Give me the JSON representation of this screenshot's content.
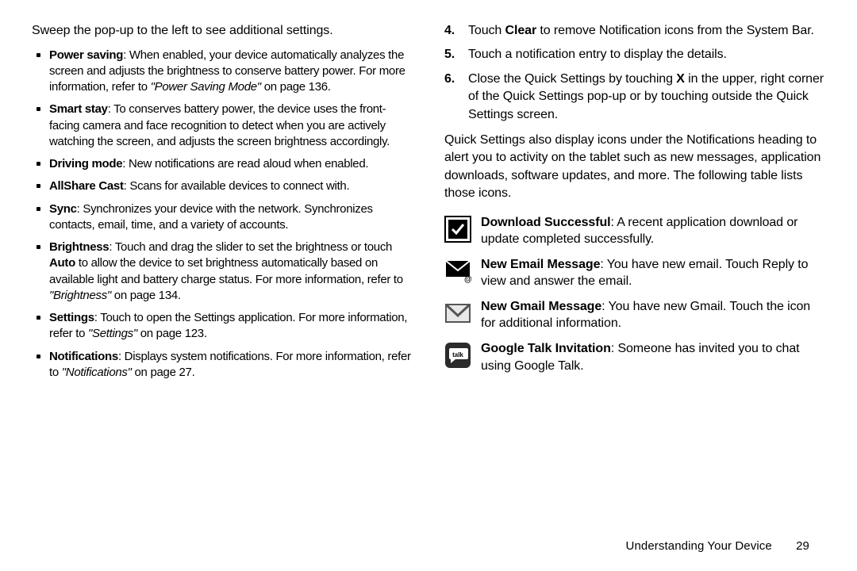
{
  "left": {
    "intro": "Sweep the pop-up to the left to see additional settings.",
    "bullets": [
      {
        "title": "Power saving",
        "body": ": When enabled, your device automatically analyzes the screen and adjusts the brightness to conserve battery power. For more information, refer to ",
        "ref": "\"Power Saving Mode\"",
        "after": "  on page 136."
      },
      {
        "title": "Smart stay",
        "body": ": To conserves battery power, the device uses the front-facing camera and face recognition to detect when you are actively watching the screen, and adjusts the screen brightness accordingly.",
        "ref": "",
        "after": ""
      },
      {
        "title": "Driving mode",
        "body": ": New notifications are read aloud when enabled.",
        "ref": "",
        "after": ""
      },
      {
        "title": "AllShare Cast",
        "body": ": Scans for available devices to connect with.",
        "ref": "",
        "after": ""
      },
      {
        "title": "Sync",
        "body": ": Synchronizes your device with the network. Synchronizes contacts, email, time, and a variety of accounts.",
        "ref": "",
        "after": ""
      },
      {
        "title": "Brightness",
        "body": ": Touch and drag the slider to set the brightness or touch ",
        "bold2": "Auto",
        "body2": " to allow the device to set brightness automatically based on available light and battery charge status. For more information, refer to ",
        "ref": "\"Brightness\"",
        "after": "  on page 134."
      },
      {
        "title": "Settings",
        "body": ": Touch to open the Settings application. For more information, refer to ",
        "ref": "\"Settings\"",
        "after": "  on page 123."
      },
      {
        "title": "Notifications",
        "body": ": Displays system notifications. For more information, refer to ",
        "ref": "\"Notifications\"",
        "after": "  on page 27."
      }
    ]
  },
  "right": {
    "steps": [
      {
        "n": "4.",
        "pre": "Touch ",
        "bold": "Clear",
        "post": " to remove Notification icons from the System Bar."
      },
      {
        "n": "5.",
        "pre": "Touch a notification entry to display the details.",
        "bold": "",
        "post": ""
      },
      {
        "n": "6.",
        "pre": "Close the Quick Settings by touching ",
        "bold": "X",
        "post": " in the upper, right corner of the Quick Settings pop-up or by touching outside the Quick Settings screen."
      }
    ],
    "para": "Quick Settings also display icons under the Notifications heading to alert you to activity on the tablet such as new messages, application downloads, software updates, and more. The following table lists those icons.",
    "icons": [
      {
        "icon": "download-success-icon",
        "title": "Download Successful",
        "body": ": A recent application download or update completed successfully."
      },
      {
        "icon": "email-icon",
        "title": "New Email Message",
        "body": ": You have new email. Touch Reply to view and answer the email."
      },
      {
        "icon": "gmail-icon",
        "title": "New Gmail Message",
        "body": ": You have new Gmail. Touch the icon for additional information."
      },
      {
        "icon": "talk-icon",
        "title": "Google Talk Invitation",
        "body": ": Someone has invited you to chat using Google Talk."
      }
    ]
  },
  "footer": {
    "section": "Understanding Your Device",
    "page": "29"
  }
}
